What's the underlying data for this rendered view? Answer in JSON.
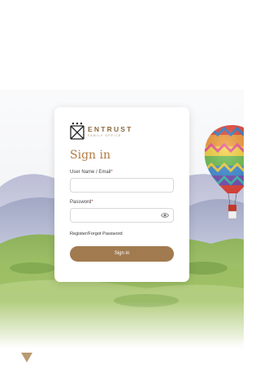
{
  "brand": {
    "name": "ENTRUST",
    "tagline": "FAMILY OFFICE"
  },
  "login": {
    "title": "Sign in",
    "username_label": "User Name / Email",
    "username_value": "",
    "password_label": "Password",
    "password_value": "",
    "required_mark": "*",
    "register_link": "Register/Forgot Password",
    "submit_label": "Sign in"
  },
  "colors": {
    "accent": "#a17a4f",
    "title": "#b07a41",
    "required": "#c0392b"
  },
  "icons": {
    "password_toggle": "eye-icon",
    "scroll": "triangle-down-icon",
    "logo": "hourglass-logo-icon"
  }
}
